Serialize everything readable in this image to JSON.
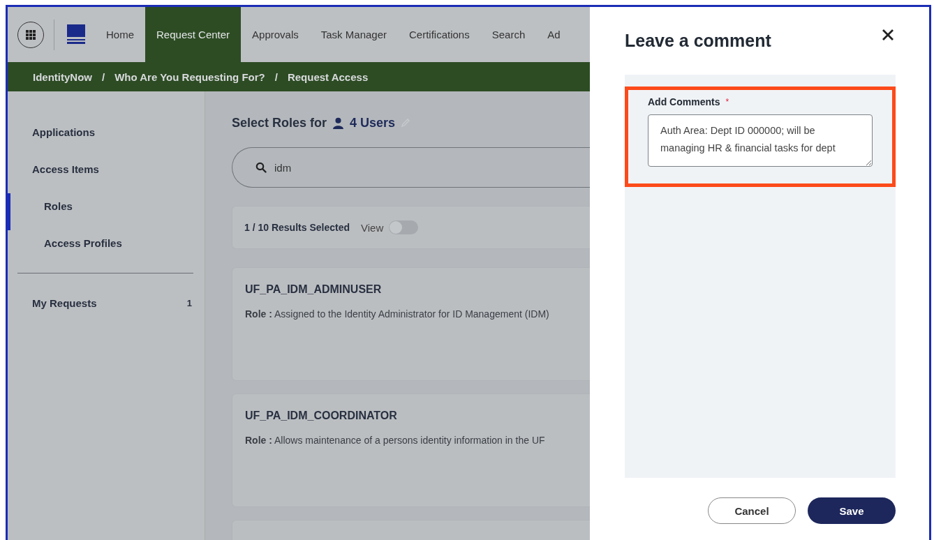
{
  "nav": {
    "items": [
      {
        "label": "Home",
        "selected": false
      },
      {
        "label": "Request Center",
        "selected": true
      },
      {
        "label": "Approvals",
        "selected": false
      },
      {
        "label": "Task Manager",
        "selected": false
      },
      {
        "label": "Certifications",
        "selected": false
      },
      {
        "label": "Search",
        "selected": false
      },
      {
        "label": "Ad",
        "selected": false
      }
    ]
  },
  "breadcrumb": {
    "separator": "/",
    "items": [
      "IdentityNow",
      "Who Are You Requesting For?",
      "Request Access"
    ]
  },
  "sidebar": {
    "items": [
      {
        "label": "Applications",
        "selected": false
      },
      {
        "label": "Access Items",
        "selected": false,
        "children": [
          {
            "label": "Roles",
            "selected": true
          },
          {
            "label": "Access Profiles",
            "selected": false
          }
        ]
      }
    ],
    "requests": {
      "label": "My Requests",
      "count": "1"
    }
  },
  "content": {
    "heading": "Select Roles for",
    "users": "4 Users",
    "search": {
      "value": "idm"
    },
    "results": {
      "label": "1 / 10 Results Selected",
      "view_label": "View",
      "view_on": false
    },
    "cards": [
      {
        "title": "UF_PA_IDM_ADMINUSER",
        "description": "**Role :** Assigned to the Identity Administrator for ID Management (IDM)"
      },
      {
        "title": "UF_PA_IDM_COORDINATOR",
        "description": "**Role :** Allows maintenance of a persons identity information in the UF"
      }
    ]
  },
  "drawer": {
    "title": "Leave a comment",
    "field_label": "Add Comments",
    "required_mark": "*",
    "comment": "Auth Area: Dept ID 000000; will be managing HR & financial tasks for dept",
    "buttons": [
      "Cancel",
      "Save"
    ]
  }
}
